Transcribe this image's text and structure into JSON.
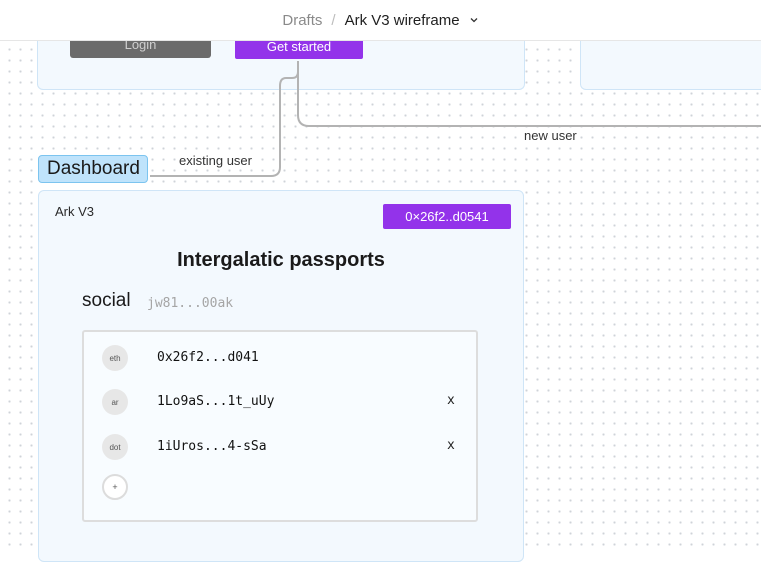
{
  "header": {
    "breadcrumb_root": "Drafts",
    "separator": "/",
    "file_title": "Ark V3 wireframe",
    "dropdown_icon": "chevron-down-icon"
  },
  "canvas": {
    "login_button_label": "Login",
    "get_started_label": "Get started",
    "connector_new_user_label": "new user",
    "connector_existing_user_label": "existing user",
    "dashboard_frame_label": "Dashboard"
  },
  "dashboard": {
    "app_name": "Ark V3",
    "wallet_address": "0×26f2..d0541",
    "title": "Intergalatic passports",
    "social_label": "social",
    "social_id": "jw81...00ak",
    "accounts": [
      {
        "chain": "eth",
        "address": "0x26f2...d041",
        "remove": ""
      },
      {
        "chain": "ar",
        "address": "1Lo9aS...1t_uUy",
        "remove": "x"
      },
      {
        "chain": "dot",
        "address": "1iUros...4-sSa",
        "remove": "x"
      }
    ],
    "add_label": "+"
  },
  "colors": {
    "accent_purple": "#9333ea",
    "frame_fill": "#f3f9fe",
    "frame_border": "#cfe5f7",
    "dashboard_tag_fill": "#bfe3fb",
    "connector": "#b3b3b3"
  }
}
